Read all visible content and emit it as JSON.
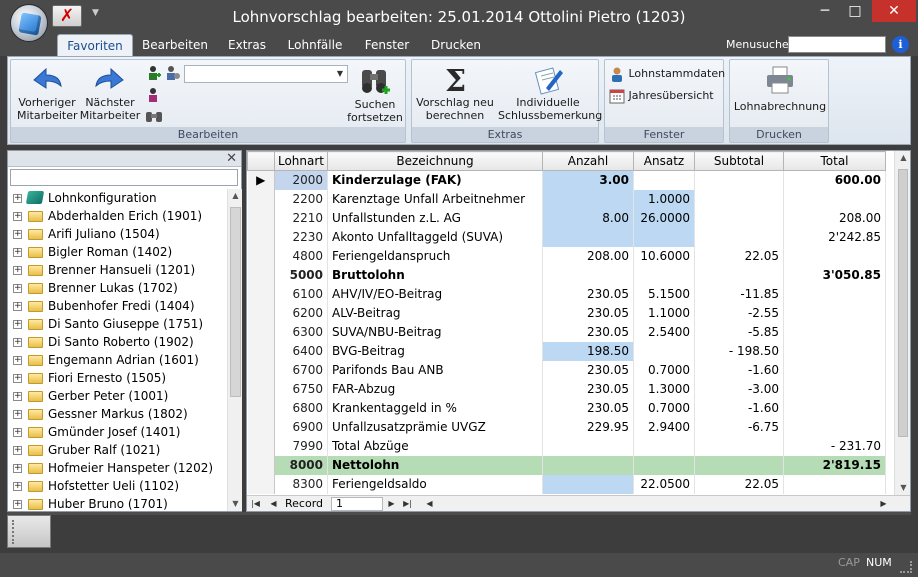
{
  "window": {
    "title": "Lohnvorschlag bearbeiten: 25.01.2014 Ottolini Pietro (1203)",
    "minimize_glyph": "─",
    "maximize_glyph": "□",
    "close_glyph": "✕"
  },
  "quick_access": {
    "close_glyph": "✗",
    "more_glyph": "▼"
  },
  "ribbon": {
    "tabs": [
      {
        "label": "Favoriten",
        "active": true
      },
      {
        "label": "Bearbeiten"
      },
      {
        "label": "Extras"
      },
      {
        "label": "Lohnfälle"
      },
      {
        "label": "Fenster"
      },
      {
        "label": "Drucken"
      }
    ],
    "menusuche_label": "Menusuche",
    "info_glyph": "i",
    "groups": {
      "bearbeiten": {
        "label": "Bearbeiten",
        "previous_line1": "Vorheriger",
        "previous_line2": "Mitarbeiter",
        "next_line1": "Nächster",
        "next_line2": "Mitarbeiter",
        "search_line1": "Suchen",
        "search_line2": "fortsetzen",
        "combo_value": ""
      },
      "extras": {
        "label": "Extras",
        "recalc_line1": "Vorschlag neu",
        "recalc_line2": "berechnen",
        "remark_line1": "Individuelle",
        "remark_line2": "Schlussbemerkung"
      },
      "fenster": {
        "label": "Fenster",
        "stammdaten": "Lohnstammdaten",
        "jahresuebersicht": "Jahresübersicht"
      },
      "drucken": {
        "label": "Drucken",
        "lohnabrechnung": "Lohnabrechnung"
      }
    }
  },
  "tree": {
    "close_glyph": "✕",
    "search_value": "",
    "items": [
      {
        "label": "Lohnkonfiguration",
        "icon": "book-icon"
      },
      {
        "label": "Abderhalden Erich (1901)"
      },
      {
        "label": "Arifi Juliano (1504)"
      },
      {
        "label": "Bigler Roman (1402)"
      },
      {
        "label": "Brenner Hansueli (1201)"
      },
      {
        "label": "Brenner Lukas (1702)"
      },
      {
        "label": "Bubenhofer Fredi (1404)"
      },
      {
        "label": "Di Santo Giuseppe (1751)"
      },
      {
        "label": "Di Santo Roberto (1902)"
      },
      {
        "label": "Engemann Adrian (1601)"
      },
      {
        "label": "Fiori Ernesto (1505)"
      },
      {
        "label": "Gerber Peter (1001)"
      },
      {
        "label": "Gessner Markus (1802)"
      },
      {
        "label": "Gmünder Josef (1401)"
      },
      {
        "label": "Gruber Ralf (1021)"
      },
      {
        "label": "Hofmeier Hanspeter (1202)"
      },
      {
        "label": "Hofstetter Ueli (1102)"
      },
      {
        "label": "Huber Bruno (1701)"
      }
    ],
    "expander_glyph": "+"
  },
  "grid": {
    "columns": {
      "lohnart": "Lohnart",
      "bezeichnung": "Bezeichnung",
      "anzahl": "Anzahl",
      "ansatz": "Ansatz",
      "subtotal": "Subtotal",
      "total": "Total"
    },
    "row_indicator": "▶",
    "rows": [
      {
        "code": "2000",
        "desc": "Kinderzulage (FAK)",
        "anzahl": "3.00",
        "ansatz": "",
        "subtotal": "",
        "total": "600.00"
      },
      {
        "code": "2200",
        "desc": "Karenztage Unfall Arbeitnehmer",
        "anzahl": "",
        "ansatz": "1.0000",
        "subtotal": "",
        "total": ""
      },
      {
        "code": "2210",
        "desc": "Unfallstunden z.L. AG",
        "anzahl": "8.00",
        "ansatz": "26.0000",
        "subtotal": "",
        "total": "208.00"
      },
      {
        "code": "2230",
        "desc": "Akonto Unfalltaggeld (SUVA)",
        "anzahl": "",
        "ansatz": "",
        "subtotal": "",
        "total": "2'242.85"
      },
      {
        "code": "4800",
        "desc": "Feriengeldanspruch",
        "anzahl": "208.00",
        "ansatz": "10.6000",
        "subtotal": "22.05",
        "total": ""
      },
      {
        "code": "5000",
        "desc": "Bruttolohn",
        "anzahl": "",
        "ansatz": "",
        "subtotal": "",
        "total": "3'050.85"
      },
      {
        "code": "6100",
        "desc": "AHV/IV/EO-Beitrag",
        "anzahl": "230.05",
        "ansatz": "5.1500",
        "subtotal": "-11.85",
        "total": ""
      },
      {
        "code": "6200",
        "desc": "ALV-Beitrag",
        "anzahl": "230.05",
        "ansatz": "1.1000",
        "subtotal": "-2.55",
        "total": ""
      },
      {
        "code": "6300",
        "desc": "SUVA/NBU-Beitrag",
        "anzahl": "230.05",
        "ansatz": "2.5400",
        "subtotal": "-5.85",
        "total": ""
      },
      {
        "code": "6400",
        "desc": "BVG-Beitrag",
        "anzahl": "198.50",
        "ansatz": "",
        "subtotal": "- 198.50",
        "total": ""
      },
      {
        "code": "6700",
        "desc": "Parifonds Bau ANB",
        "anzahl": "230.05",
        "ansatz": "0.7000",
        "subtotal": "-1.60",
        "total": ""
      },
      {
        "code": "6750",
        "desc": "FAR-Abzug",
        "anzahl": "230.05",
        "ansatz": "1.3000",
        "subtotal": "-3.00",
        "total": ""
      },
      {
        "code": "6800",
        "desc": "Krankentaggeld in %",
        "anzahl": "230.05",
        "ansatz": "0.7000",
        "subtotal": "-1.60",
        "total": ""
      },
      {
        "code": "6900",
        "desc": "Unfallzusatzprämie UVGZ",
        "anzahl": "229.95",
        "ansatz": "2.9400",
        "subtotal": "-6.75",
        "total": ""
      },
      {
        "code": "7990",
        "desc": "Total Abzüge",
        "anzahl": "",
        "ansatz": "",
        "subtotal": "",
        "total": "- 231.70"
      },
      {
        "code": "8000",
        "desc": "Nettolohn",
        "anzahl": "",
        "ansatz": "",
        "subtotal": "",
        "total": "2'819.15"
      },
      {
        "code": "8300",
        "desc": "Feriengeldsaldo",
        "anzahl": "",
        "ansatz": "22.0500",
        "subtotal": "22.05",
        "total": ""
      }
    ],
    "footer": {
      "first_glyph": "|◀",
      "prev_glyph": "◀",
      "record_label": "Record",
      "record_value": "1",
      "next_glyph": "▶",
      "last_glyph": "▶|",
      "hscroll_left": "◀",
      "hscroll_right": "▶"
    }
  },
  "status": {
    "cap": "CAP",
    "num": "NUM"
  }
}
